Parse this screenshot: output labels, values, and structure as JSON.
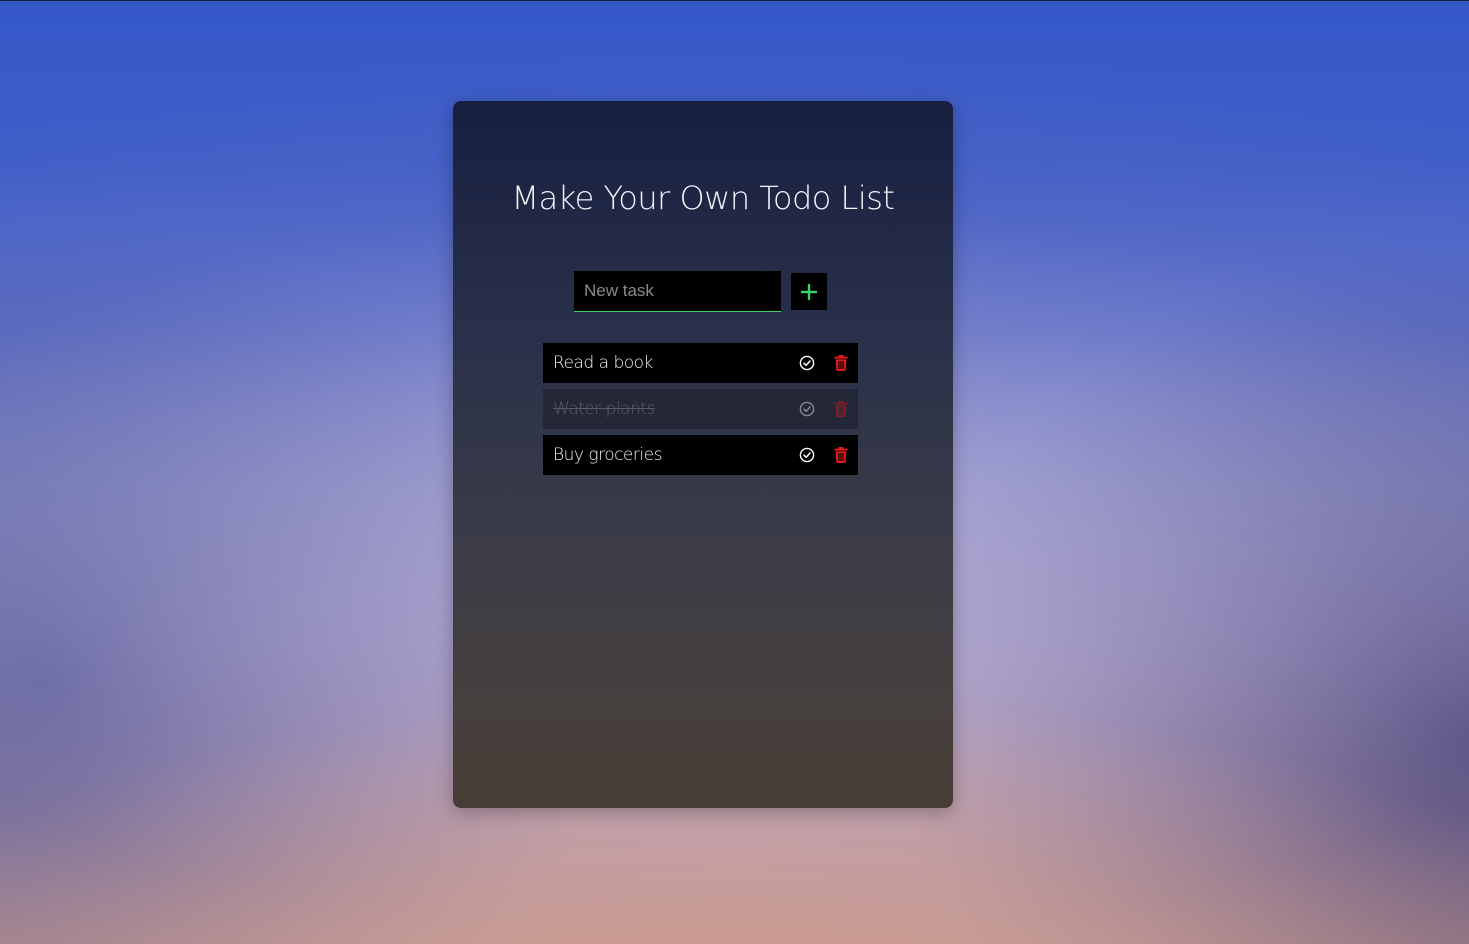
{
  "app": {
    "title": "Make Your Own Todo List"
  },
  "input": {
    "placeholder": "New task",
    "value": ""
  },
  "add_button": {
    "icon": "plus-icon",
    "color": "#3dd16a"
  },
  "todos": [
    {
      "text": "Read a book",
      "completed": false
    },
    {
      "text": "Water plants",
      "completed": true
    },
    {
      "text": "Buy groceries",
      "completed": false
    }
  ],
  "colors": {
    "accent": "#3dd16a",
    "delete": "#e01b1b",
    "check": "#ffffff"
  }
}
